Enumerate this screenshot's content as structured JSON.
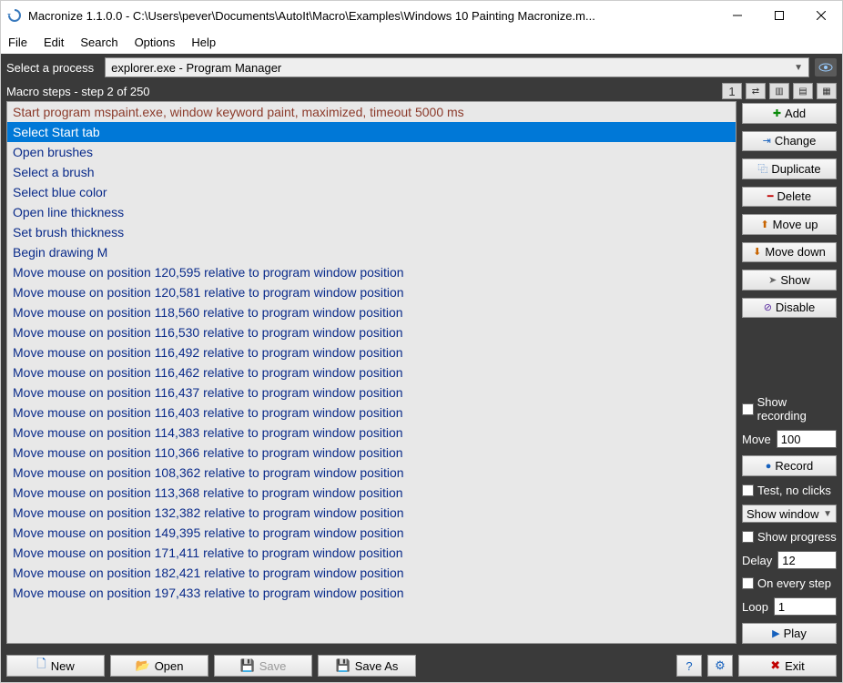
{
  "title": "Macronize 1.1.0.0 - C:\\Users\\pever\\Documents\\AutoIt\\Macro\\Examples\\Windows 10 Painting Macronize.m...",
  "menu": {
    "file": "File",
    "edit": "Edit",
    "search": "Search",
    "options": "Options",
    "help": "Help"
  },
  "process": {
    "label": "Select a process",
    "value": "explorer.exe - Program Manager"
  },
  "steps_header": "Macro steps - step 2 of 250",
  "tool1": "1",
  "steps": [
    {
      "t": "Start program mspaint.exe, window keyword paint, maximized, timeout 5000 ms",
      "kind": "program"
    },
    {
      "t": "Select Start tab",
      "kind": "selected"
    },
    {
      "t": "Open brushes",
      "kind": "normal"
    },
    {
      "t": "Select a brush",
      "kind": "normal"
    },
    {
      "t": "Select blue color",
      "kind": "normal"
    },
    {
      "t": "Open line thickness",
      "kind": "normal"
    },
    {
      "t": "Set brush thickness",
      "kind": "normal"
    },
    {
      "t": "Begin drawing M",
      "kind": "normal"
    },
    {
      "t": "Move mouse on position 120,595 relative to program window position",
      "kind": "normal"
    },
    {
      "t": "Move mouse on position 120,581 relative to program window position",
      "kind": "normal"
    },
    {
      "t": "Move mouse on position 118,560 relative to program window position",
      "kind": "normal"
    },
    {
      "t": "Move mouse on position 116,530 relative to program window position",
      "kind": "normal"
    },
    {
      "t": "Move mouse on position 116,492 relative to program window position",
      "kind": "normal"
    },
    {
      "t": "Move mouse on position 116,462 relative to program window position",
      "kind": "normal"
    },
    {
      "t": "Move mouse on position 116,437 relative to program window position",
      "kind": "normal"
    },
    {
      "t": "Move mouse on position 116,403 relative to program window position",
      "kind": "normal"
    },
    {
      "t": "Move mouse on position 114,383 relative to program window position",
      "kind": "normal"
    },
    {
      "t": "Move mouse on position 110,366 relative to program window position",
      "kind": "normal"
    },
    {
      "t": "Move mouse on position 108,362 relative to program window position",
      "kind": "normal"
    },
    {
      "t": "Move mouse on position 113,368 relative to program window position",
      "kind": "normal"
    },
    {
      "t": "Move mouse on position 132,382 relative to program window position",
      "kind": "normal"
    },
    {
      "t": "Move mouse on position 149,395 relative to program window position",
      "kind": "normal"
    },
    {
      "t": "Move mouse on position 171,411 relative to program window position",
      "kind": "normal"
    },
    {
      "t": "Move mouse on position 182,421 relative to program window position",
      "kind": "normal"
    },
    {
      "t": "Move mouse on position 197,433 relative to program window position",
      "kind": "normal"
    }
  ],
  "side": {
    "add": "Add",
    "change": "Change",
    "duplicate": "Duplicate",
    "delete": "Delete",
    "moveup": "Move up",
    "movedown": "Move down",
    "show": "Show",
    "disable": "Disable",
    "show_recording": "Show recording",
    "move_lbl": "Move",
    "move_val": "100",
    "record": "Record",
    "test": "Test, no clicks",
    "show_window": "Show window",
    "show_progress": "Show progress",
    "delay_lbl": "Delay",
    "delay_val": "12",
    "every_step": "On every step",
    "loop_lbl": "Loop",
    "loop_val": "1",
    "play": "Play"
  },
  "bottom": {
    "new": "New",
    "open": "Open",
    "save": "Save",
    "saveas": "Save As",
    "exit": "Exit"
  }
}
